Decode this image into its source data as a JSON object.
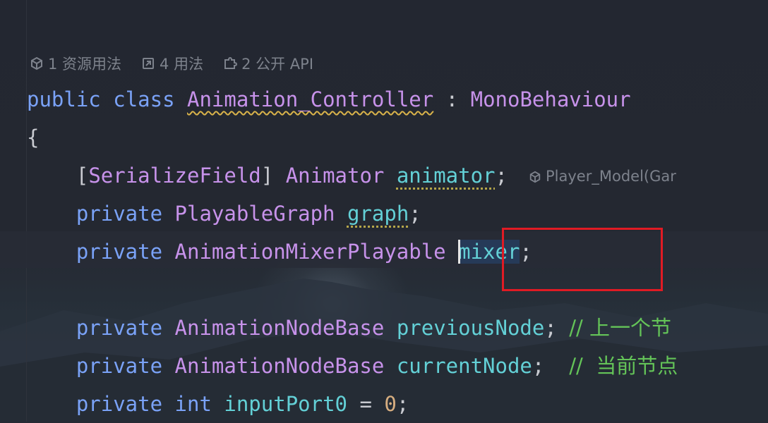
{
  "code_hints": {
    "asset_usages": "1 资源用法",
    "usages": "4 用法",
    "public_api": "2 公开 API"
  },
  "code": {
    "kw_public": "public",
    "kw_class": "class",
    "class_name": "Animation_Controller",
    "colon": " : ",
    "base_class": "MonoBehaviour",
    "open_brace": "{",
    "attr_open": "[",
    "attr_name": "SerializeField",
    "attr_close": "]",
    "animator_type": "Animator",
    "animator_field": "animator",
    "semicolon": ";",
    "inlay_hint": "Player_Model(Gar",
    "kw_private": "private",
    "graph_type": "PlayableGraph",
    "graph_field": "graph",
    "mixer_type": "AnimationMixerPlayable",
    "mixer_field": "mixer",
    "node_type": "AnimationNodeBase",
    "previous_field": "previousNode",
    "previous_comment": "// 上一个节",
    "current_field": "currentNode",
    "current_comment": "//  当前节点",
    "kw_int": "int",
    "input_field": "inputPort0",
    "equals": " = ",
    "zero": "0"
  },
  "colors": {
    "keyword": "#7aa2f7",
    "type": "#c792ea",
    "field": "#63d0d6",
    "comment": "#64c458",
    "annotation_box": "#e01b24"
  },
  "icons": [
    "unity-icon",
    "usages-arrow-icon",
    "public-api-icon"
  ]
}
